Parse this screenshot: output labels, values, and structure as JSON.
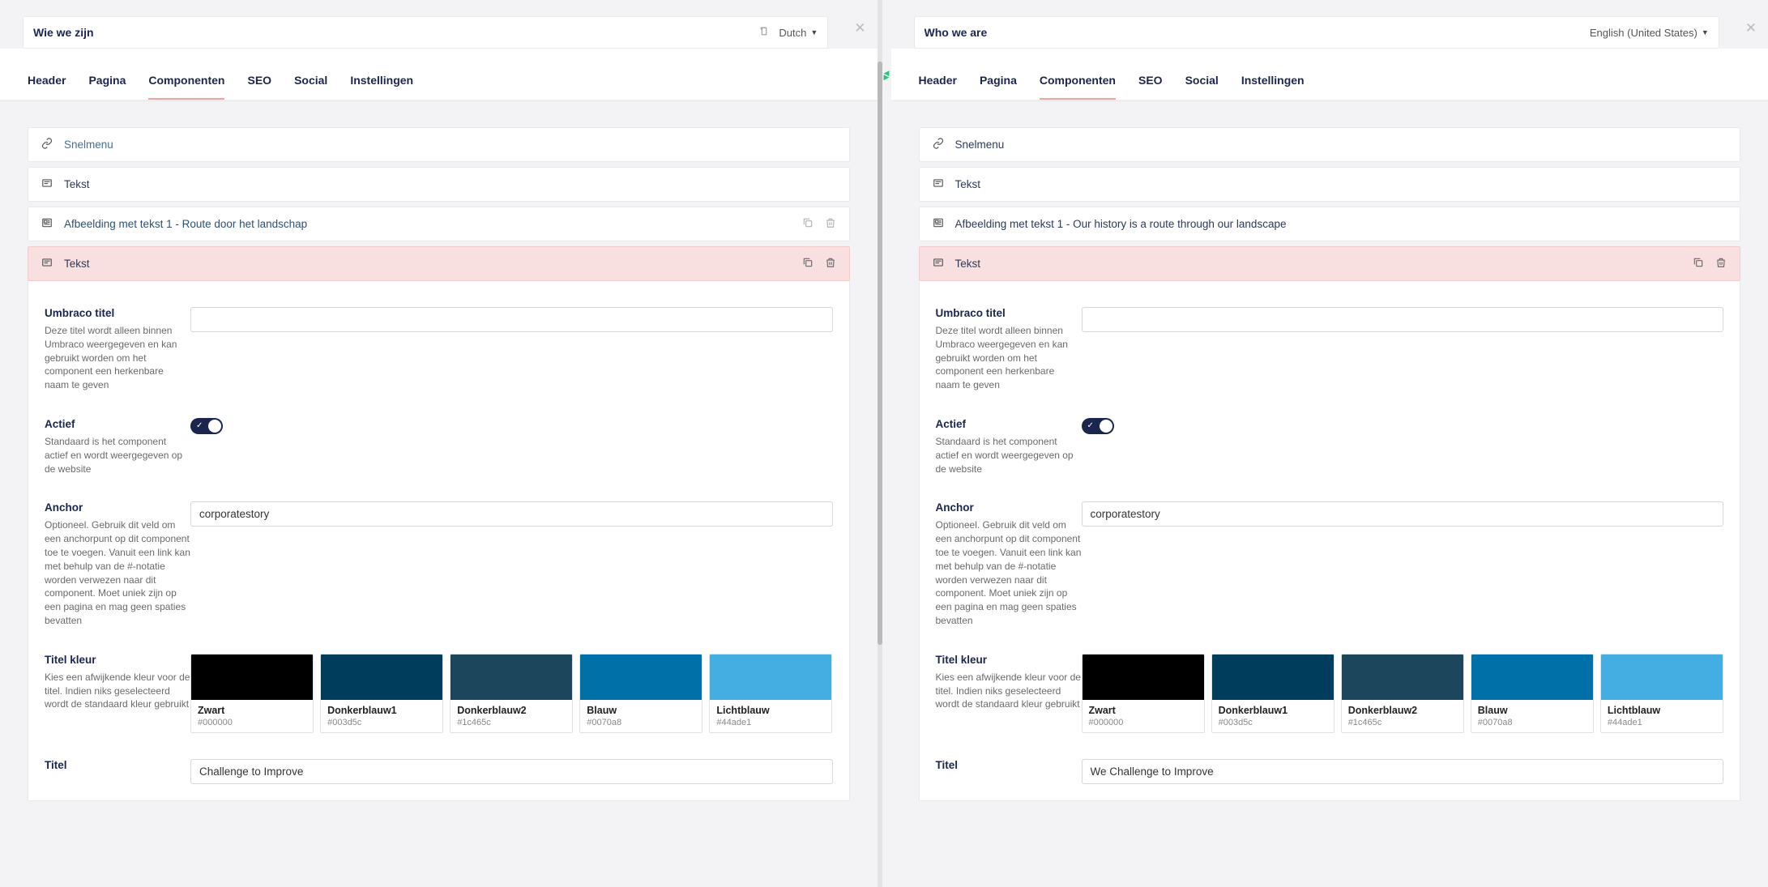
{
  "left": {
    "title": "Wie we zijn",
    "language": "Dutch",
    "tabs": [
      "Header",
      "Pagina",
      "Componenten",
      "SEO",
      "Social",
      "Instellingen"
    ],
    "activeTab": 2,
    "rows": {
      "snelmenu": "Snelmenu",
      "tekst1": "Tekst",
      "afbeelding": "Afbeelding met tekst 1 - Route door het landschap",
      "tekst2": "Tekst"
    },
    "fields": {
      "umbracoTitel": {
        "label": "Umbraco titel",
        "desc": "Deze titel wordt alleen binnen Umbraco weergegeven en kan gebruikt worden om het component een herkenbare naam te geven",
        "value": ""
      },
      "actief": {
        "label": "Actief",
        "desc": "Standaard is het component actief en wordt weergegeven op de website"
      },
      "anchor": {
        "label": "Anchor",
        "desc": "Optioneel. Gebruik dit veld om een anchorpunt op dit component toe te voegen. Vanuit een link kan met behulp van de #-notatie worden verwezen naar dit component. Moet uniek zijn op een pagina en mag geen spaties bevatten",
        "value": "corporatestory"
      },
      "titelKleur": {
        "label": "Titel kleur",
        "desc": "Kies een afwijkende kleur voor de titel. Indien niks geselecteerd wordt de standaard kleur gebruikt"
      },
      "titel": {
        "label": "Titel",
        "value": "Challenge to Improve"
      }
    }
  },
  "right": {
    "title": "Who we are",
    "language": "English (United States)",
    "tabs": [
      "Header",
      "Pagina",
      "Componenten",
      "SEO",
      "Social",
      "Instellingen"
    ],
    "activeTab": 2,
    "rows": {
      "snelmenu": "Snelmenu",
      "tekst1": "Tekst",
      "afbeelding": "Afbeelding met tekst 1 - Our history is a route through our landscape",
      "tekst2": "Tekst"
    },
    "fields": {
      "umbracoTitel": {
        "label": "Umbraco titel",
        "desc": "Deze titel wordt alleen binnen Umbraco weergegeven en kan gebruikt worden om het component een herkenbare naam te geven",
        "value": ""
      },
      "actief": {
        "label": "Actief",
        "desc": "Standaard is het component actief en wordt weergegeven op de website"
      },
      "anchor": {
        "label": "Anchor",
        "desc": "Optioneel. Gebruik dit veld om een anchorpunt op dit component toe te voegen. Vanuit een link kan met behulp van de #-notatie worden verwezen naar dit component. Moet uniek zijn op een pagina en mag geen spaties bevatten",
        "value": "corporatestory"
      },
      "titelKleur": {
        "label": "Titel kleur",
        "desc": "Kies een afwijkende kleur voor de titel. Indien niks geselecteerd wordt de standaard kleur gebruikt"
      },
      "titel": {
        "label": "Titel",
        "value": "We Challenge to Improve"
      }
    }
  },
  "colors": [
    {
      "name": "Zwart",
      "hex": "#000000"
    },
    {
      "name": "Donkerblauw1",
      "hex": "#003d5c"
    },
    {
      "name": "Donkerblauw2",
      "hex": "#1c465c"
    },
    {
      "name": "Blauw",
      "hex": "#0070a8"
    },
    {
      "name": "Lichtblauw",
      "hex": "#44ade1"
    }
  ]
}
